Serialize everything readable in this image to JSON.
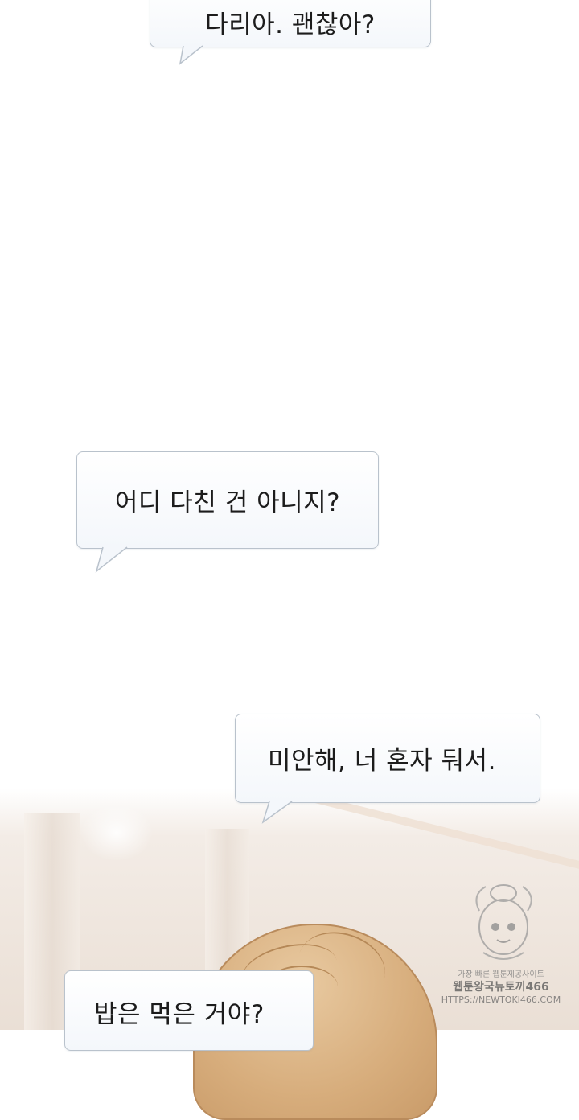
{
  "dialogue": [
    {
      "text": "다리아. 괜찮아?"
    },
    {
      "text": "어디 다친 건 아니지?"
    },
    {
      "text": "미안해, 너 혼자 둬서."
    },
    {
      "text": "밥은 먹은 거야?"
    }
  ],
  "watermark": {
    "line1": "가장 빠른 웹툰제공사이트",
    "line2": "웹툰왕국뉴토끼466",
    "line3": "HTTPS://NEWTOKI466.COM"
  },
  "colors": {
    "bubble_border": "#b9c2cc",
    "text": "#1c1c1c",
    "hair": "#d7ad7c"
  }
}
